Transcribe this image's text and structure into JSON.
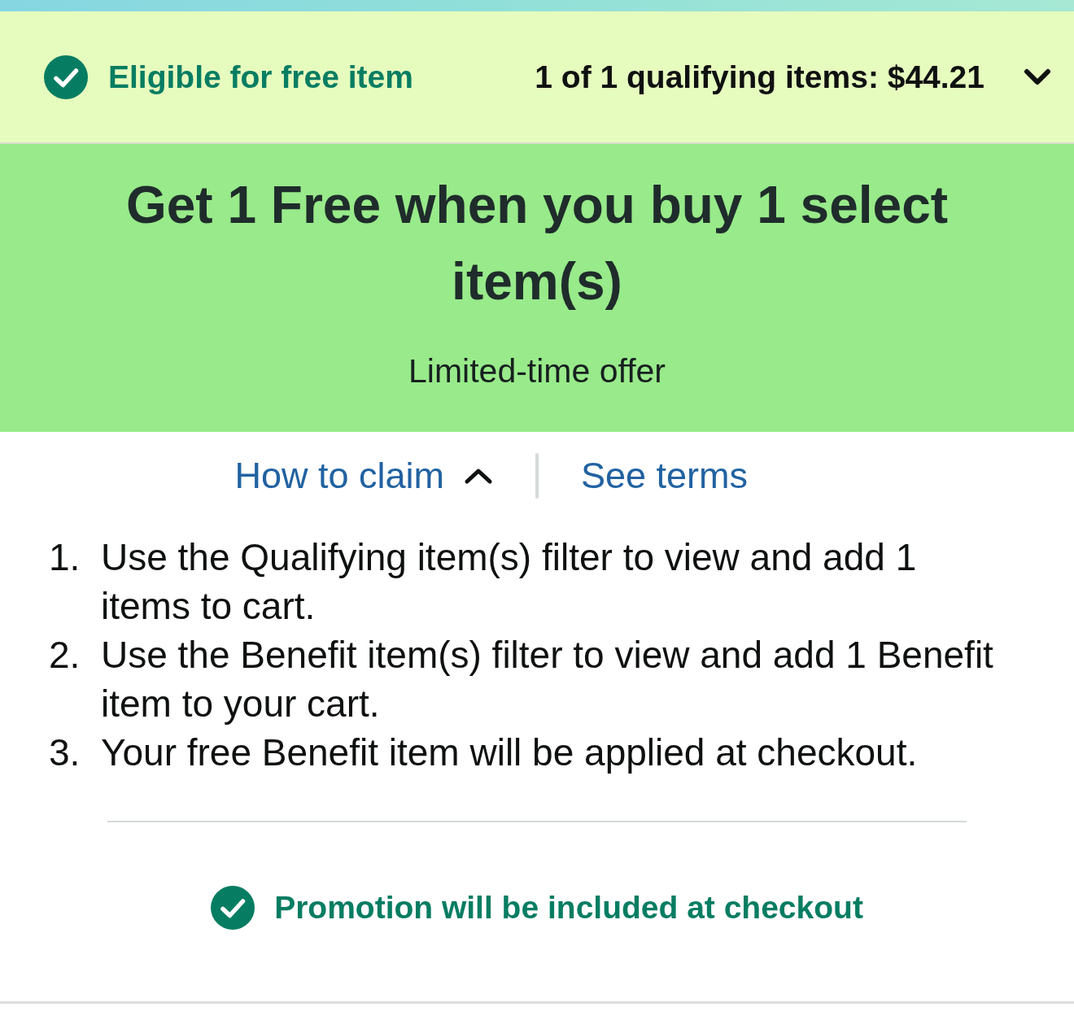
{
  "header": {
    "status": "Eligible for free item",
    "summary": "1 of 1 qualifying items: $44.21",
    "expanded": false
  },
  "banner": {
    "title": "Get 1 Free when you buy 1 select item(s)",
    "subtitle": "Limited-time offer"
  },
  "links": [
    {
      "kind": "toggle",
      "label": "How to claim",
      "expanded": true
    },
    {
      "kind": "link",
      "label": "See terms"
    }
  ],
  "steps": [
    {
      "number": "1.",
      "text": "Use the Qualifying item(s) filter to view and add 1 items to cart."
    },
    {
      "number": "2.",
      "text": "Use the Benefit item(s) filter to view and add 1 Benefit item to your cart."
    },
    {
      "number": "3.",
      "text": "Your free Benefit item will be applied at checkout."
    }
  ],
  "footer": {
    "message": "Promotion will be included at checkout"
  }
}
